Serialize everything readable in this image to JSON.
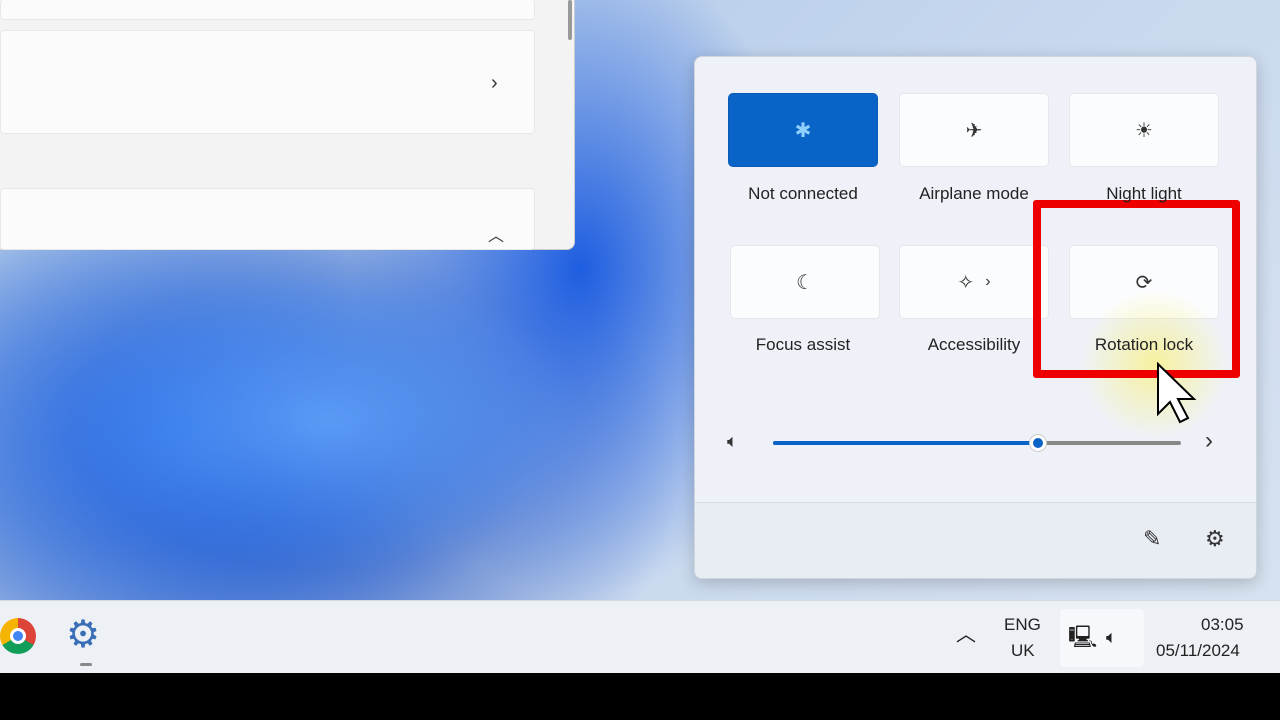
{
  "quick_settings": {
    "tiles": [
      {
        "label": "Not connected",
        "icon": "bluetooth-icon",
        "active": true
      },
      {
        "label": "Airplane mode",
        "icon": "airplane-icon",
        "active": false
      },
      {
        "label": "Night light",
        "icon": "night-light-icon",
        "active": false
      },
      {
        "label": "Focus assist",
        "icon": "moon-icon",
        "active": false
      },
      {
        "label": "Accessibility",
        "icon": "accessibility-icon",
        "active": false
      },
      {
        "label": "Rotation lock",
        "icon": "rotation-lock-icon",
        "active": false
      }
    ],
    "volume_percent": 65,
    "accent": "#0a64c8"
  },
  "taskbar": {
    "lang": "ENG",
    "region": "UK",
    "time": "03:05",
    "date": "05/11/2024"
  },
  "highlight_color": "#ee0000"
}
